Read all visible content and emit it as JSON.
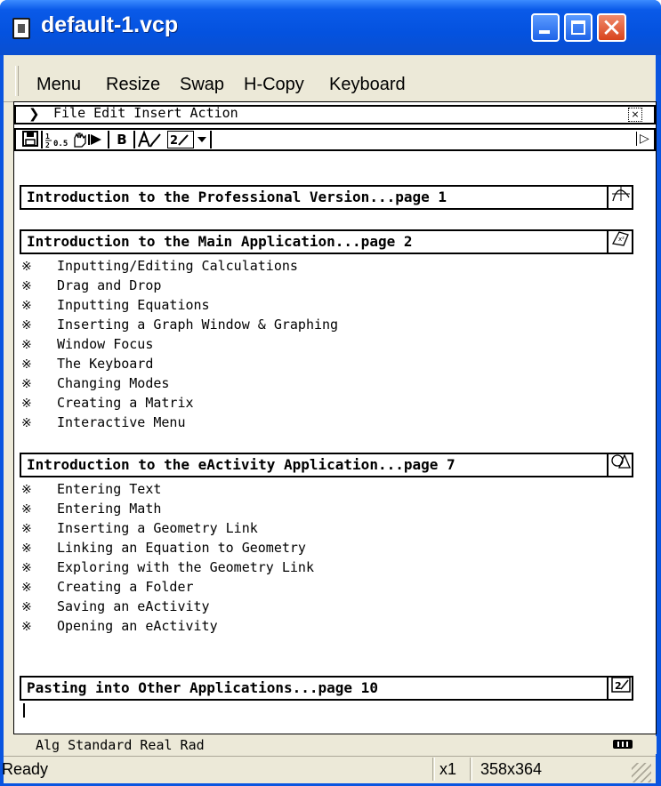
{
  "window": {
    "title": "default-1.vcp",
    "controls": {
      "minimize": "",
      "maximize": "",
      "close": "✕"
    }
  },
  "menubar": {
    "items": [
      "Menu",
      "Resize",
      "Swap",
      "H-Copy",
      "Keyboard"
    ]
  },
  "command_bar": {
    "text": "File Edit Insert Action",
    "close": "⨯"
  },
  "toolbar": {
    "bold_label": "B"
  },
  "document": {
    "sections": [
      {
        "title": "Introduction to the Professional Version...page 1",
        "icon": "graph-icon",
        "items": []
      },
      {
        "title": "Introduction to the Main Application...page 2",
        "icon": "main-app-icon",
        "items": [
          "Inputting/Editing Calculations",
          "Drag and Drop",
          "Inputting Equations",
          "Inserting a Graph Window & Graphing",
          "Window Focus",
          "The Keyboard",
          "Changing Modes",
          "Creating a Matrix",
          "Interactive Menu"
        ]
      },
      {
        "title": "Introduction to the eActivity Application...page 7",
        "icon": "geometry-icon",
        "items": [
          "Entering Text",
          "Entering Math",
          "Inserting a Geometry Link",
          "Linking an Equation to Geometry",
          "Exploring with the Geometry Link",
          "Creating a Folder",
          "Saving an eActivity",
          "Opening an eActivity"
        ]
      },
      {
        "title": "Pasting into Other Applications...page 10",
        "icon": "eactivity-icon",
        "items": []
      }
    ],
    "bullet": "※"
  },
  "modebar": {
    "text": "Alg  Standard Real Rad"
  },
  "statusbar": {
    "status": "Ready",
    "zoom": "x1",
    "size": "358x364"
  },
  "colors": {
    "titlebar": "#0452df",
    "close": "#d8431c",
    "chrome": "#ece9d8"
  }
}
